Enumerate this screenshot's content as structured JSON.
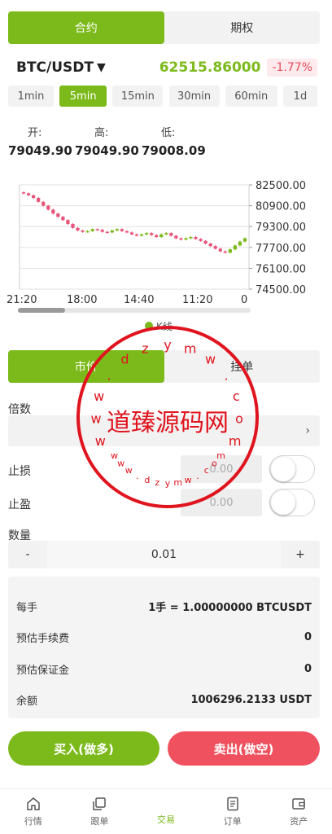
{
  "segment_main": {
    "tabs": [
      "合约",
      "期权"
    ],
    "active": 0
  },
  "pair": {
    "name": "BTC/USDT",
    "caret": "▼",
    "price": "62515.86000",
    "change": "-1.77%"
  },
  "periods": {
    "items": [
      "1min",
      "5min",
      "15min",
      "30min",
      "60min",
      "1d"
    ],
    "active": 1
  },
  "ohl": {
    "open_label": "开:",
    "high_label": "高:",
    "low_label": "低:",
    "open": "79049.90",
    "high": "79049.90",
    "low": "79008.09"
  },
  "chart_data": {
    "type": "candlestick",
    "y_ticks": [
      "82500.00",
      "80900.00",
      "79300.00",
      "77700.00",
      "76100.00",
      "74500.00"
    ],
    "ylim": [
      74500,
      82500
    ],
    "x_ticks": [
      "21:20",
      "18:00",
      "14:40",
      "11:20",
      "0"
    ],
    "legend": "K线",
    "colors": {
      "up": "#7cba1b",
      "down": "#e8557a"
    },
    "close_path": [
      81850,
      81700,
      81500,
      81200,
      80900,
      80600,
      80300,
      80050,
      79800,
      79500,
      79200,
      79000,
      78900,
      78950,
      79100,
      79050,
      78900,
      78850,
      79000,
      79100,
      78950,
      78850,
      78700,
      78600,
      78700,
      78800,
      78650,
      78500,
      78700,
      78800,
      78600,
      78400,
      78300,
      78400,
      78500,
      78350,
      78200,
      78000,
      77800,
      77600,
      77400,
      77300,
      77550,
      77850,
      78150,
      78400
    ]
  },
  "segment_order": {
    "tabs": [
      "市价",
      "挂单"
    ],
    "active": 0
  },
  "form": {
    "multiplier_label": "倍数",
    "multiplier_chevron": "›",
    "stop_loss_label": "止损",
    "stop_loss_value": "0.00",
    "take_profit_label": "止盈",
    "take_profit_value": "0.00",
    "quantity_label": "数量",
    "minus": "-",
    "plus": "+",
    "quantity": "0.01"
  },
  "info": {
    "per_hand_label": "每手",
    "per_hand_value": "1手 = 1.00000000 BTCUSDT",
    "fee_label": "预估手续费",
    "fee_value": "0",
    "margin_label": "预估保证金",
    "margin_value": "0",
    "balance_label": "余额",
    "balance_value": "1006296.2133 USDT"
  },
  "actions": {
    "buy": "买入(做多)",
    "sell": "卖出(做空)"
  },
  "tabbar": {
    "items": [
      {
        "label": "行情",
        "icon": "home-icon"
      },
      {
        "label": "跟单",
        "icon": "copy-icon"
      },
      {
        "label": "交易",
        "icon": "trade-icon"
      },
      {
        "label": "订单",
        "icon": "order-icon"
      },
      {
        "label": "资产",
        "icon": "wallet-icon"
      }
    ],
    "active": 2
  },
  "watermark": {
    "title": "道臻源码网",
    "ring_text": "www.dzymw.com"
  },
  "theme": {
    "accent": "#7cba1b",
    "danger": "#f0515f"
  }
}
